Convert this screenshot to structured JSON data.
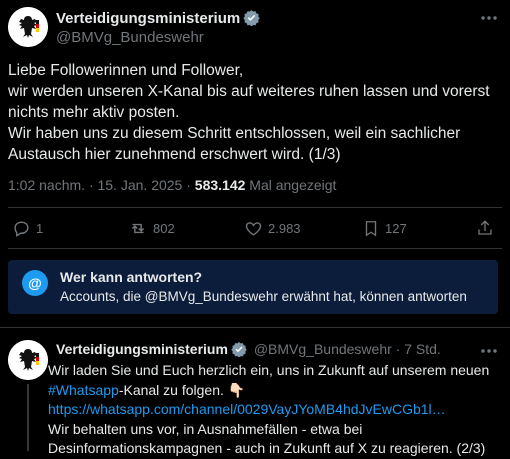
{
  "tweet": {
    "author_name": "Verteidigungsministerium",
    "author_handle": "@BMVg_Bundeswehr",
    "more_icon": "more-horizontal-icon",
    "lines": [
      "Liebe Followerinnen und Follower,",
      "wir werden unseren X-Kanal bis auf weiteres ruhen lassen und vorerst",
      "nichts mehr aktiv posten.",
      "Wir haben uns zu diesem Schritt entschlossen, weil ein sachlicher",
      "Austausch hier zunehmend erschwert wird. (1/3)"
    ],
    "timestamp": "1:02 nachm. · 15. Jan. 2025 · ",
    "views_count": "583.142",
    "views_label": " Mal angezeigt",
    "actions": {
      "replies": "1",
      "reposts": "802",
      "likes": "2.983",
      "bookmarks": "127"
    }
  },
  "reply_restriction": {
    "title": "Wer kann antworten?",
    "description": "Accounts, die @BMVg_Bundeswehr erwähnt hat, können antworten",
    "badge": "@"
  },
  "next_tweet": {
    "author_name": "Verteidigungsministerium",
    "author_handle": "@BMVg_Bundeswehr",
    "separator": " · ",
    "time": "7 Std.",
    "line1": "Wir laden Sie und Euch herzlich ein, uns in Zukunft auf unserem neuen",
    "hashtag": "#Whatsapp",
    "line2_rest": "-Kanal zu folgen. 👇🏻",
    "link": "https://whatsapp.com/channel/0029VayJYoMB4hdJvEwCGb1l…",
    "line4": "Wir behalten uns vor, in Ausnahmefällen - etwa bei",
    "line5": "Desinformationskampagnen - auch in Zukunft auf X zu reagieren. (2/3)"
  },
  "colors": {
    "accent": "#1d9bf0",
    "background": "#000000",
    "muted": "#71767b",
    "reply_box": "#0c1d3b"
  }
}
